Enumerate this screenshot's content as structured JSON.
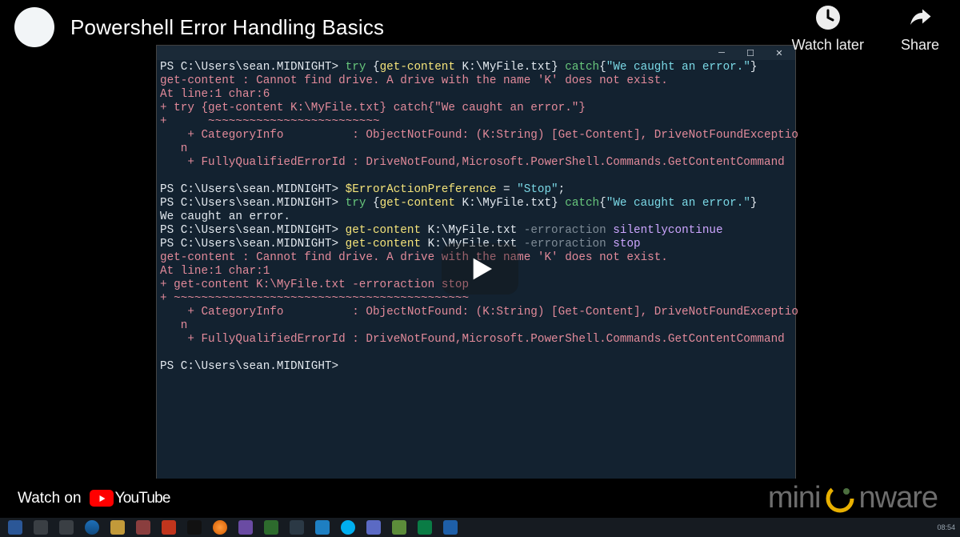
{
  "video": {
    "title": "Powershell Error Handling Basics"
  },
  "actions": {
    "watch_later": "Watch later",
    "share": "Share"
  },
  "bottom": {
    "watch_on": "Watch on",
    "youtube": "YouTube",
    "brand_left": "mini",
    "brand_right": "nware"
  },
  "terminal": {
    "prompt": "PS C:\\Users\\sean.MIDNIGHT>",
    "lines": [
      {
        "type": "cmd",
        "segments": [
          {
            "c": "white",
            "t": "PS C:\\Users\\sean.MIDNIGHT> "
          },
          {
            "c": "kw",
            "t": "try "
          },
          {
            "c": "white",
            "t": "{"
          },
          {
            "c": "cmd",
            "t": "get-content"
          },
          {
            "c": "white",
            "t": " K:\\MyFile.txt} "
          },
          {
            "c": "kw",
            "t": "catch"
          },
          {
            "c": "white",
            "t": "{"
          },
          {
            "c": "cyan",
            "t": "\"We caught an error.\""
          },
          {
            "c": "white",
            "t": "}"
          }
        ]
      },
      {
        "type": "err",
        "t": "get-content : Cannot find drive. A drive with the name 'K' does not exist."
      },
      {
        "type": "err",
        "t": "At line:1 char:6"
      },
      {
        "type": "err",
        "t": "+ try {get-content K:\\MyFile.txt} catch{\"We caught an error.\"}"
      },
      {
        "type": "err",
        "t": "+      ~~~~~~~~~~~~~~~~~~~~~~~~~"
      },
      {
        "type": "err",
        "t": "    + CategoryInfo          : ObjectNotFound: (K:String) [Get-Content], DriveNotFoundExceptio"
      },
      {
        "type": "err",
        "t": "   n"
      },
      {
        "type": "err",
        "t": "    + FullyQualifiedErrorId : DriveNotFound,Microsoft.PowerShell.Commands.GetContentCommand"
      },
      {
        "type": "blank",
        "t": ""
      },
      {
        "type": "cmd",
        "segments": [
          {
            "c": "white",
            "t": "PS C:\\Users\\sean.MIDNIGHT> "
          },
          {
            "c": "cmd",
            "t": "$ErrorActionPreference"
          },
          {
            "c": "white",
            "t": " = "
          },
          {
            "c": "cyan",
            "t": "\"Stop\""
          },
          {
            "c": "white",
            "t": ";"
          }
        ]
      },
      {
        "type": "cmd",
        "segments": [
          {
            "c": "white",
            "t": "PS C:\\Users\\sean.MIDNIGHT> "
          },
          {
            "c": "kw",
            "t": "try "
          },
          {
            "c": "white",
            "t": "{"
          },
          {
            "c": "cmd",
            "t": "get-content"
          },
          {
            "c": "white",
            "t": " K:\\MyFile.txt} "
          },
          {
            "c": "kw",
            "t": "catch"
          },
          {
            "c": "white",
            "t": "{"
          },
          {
            "c": "cyan",
            "t": "\"We caught an error.\""
          },
          {
            "c": "white",
            "t": "}"
          }
        ]
      },
      {
        "type": "out",
        "t": "We caught an error."
      },
      {
        "type": "cmd",
        "segments": [
          {
            "c": "white",
            "t": "PS C:\\Users\\sean.MIDNIGHT> "
          },
          {
            "c": "cmd",
            "t": "get-content"
          },
          {
            "c": "white",
            "t": " K:\\MyFile.txt "
          },
          {
            "c": "param",
            "t": "-erroraction"
          },
          {
            "c": "white",
            "t": " "
          },
          {
            "c": "purple",
            "t": "silentlycontinue"
          }
        ]
      },
      {
        "type": "cmd",
        "segments": [
          {
            "c": "white",
            "t": "PS C:\\Users\\sean.MIDNIGHT> "
          },
          {
            "c": "cmd",
            "t": "get-content"
          },
          {
            "c": "white",
            "t": " K:\\MyFile.txt "
          },
          {
            "c": "param",
            "t": "-erroraction"
          },
          {
            "c": "white",
            "t": " "
          },
          {
            "c": "purple",
            "t": "stop"
          }
        ]
      },
      {
        "type": "err",
        "t": "get-content : Cannot find drive. A drive with the name 'K' does not exist."
      },
      {
        "type": "err",
        "t": "At line:1 char:1"
      },
      {
        "type": "err",
        "t": "+ get-content K:\\MyFile.txt -erroraction stop"
      },
      {
        "type": "err",
        "t": "+ ~~~~~~~~~~~~~~~~~~~~~~~~~~~~~~~~~~~~~~~~~~~"
      },
      {
        "type": "err",
        "t": "    + CategoryInfo          : ObjectNotFound: (K:String) [Get-Content], DriveNotFoundExceptio"
      },
      {
        "type": "err",
        "t": "   n"
      },
      {
        "type": "err",
        "t": "    + FullyQualifiedErrorId : DriveNotFound,Microsoft.PowerShell.Commands.GetContentCommand"
      },
      {
        "type": "blank",
        "t": ""
      },
      {
        "type": "cmd",
        "segments": [
          {
            "c": "white",
            "t": "PS C:\\Users\\sean.MIDNIGHT> "
          }
        ]
      }
    ]
  },
  "taskbar": {
    "clock": "08:54"
  }
}
